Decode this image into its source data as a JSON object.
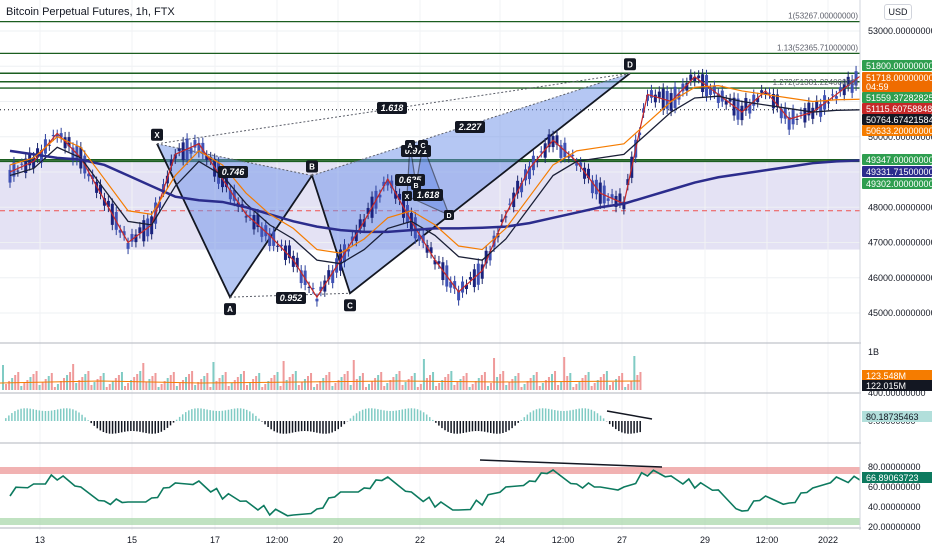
{
  "header": {
    "title": "Bitcoin Perpetual Futures, 1h, FTX",
    "currency": "USD"
  },
  "colors": {
    "price_up": "#26a69a",
    "price_down": "#ef5350",
    "level_line": "#1b5e20",
    "pattern_fill": "#6b8fe8",
    "ma_dark": "#1a1f36",
    "ma_orange": "#f57c00",
    "ma_red": "#c62828",
    "ma_navy": "#2b2c8c",
    "ma_green": "#2e7d32",
    "rsi": "#0d7a5f",
    "zone": "#d9d6ef"
  },
  "chart_data": [
    {
      "type": "line",
      "panel": "price",
      "y_ticks": [
        "53000.00000000",
        "52000.00000000",
        "51000.00000000",
        "50000.00000000",
        "49000.00000000",
        "48000.00000000",
        "47000.00000000",
        "46000.00000000",
        "45000.00000000"
      ],
      "x_ticks": [
        "13",
        "15",
        "17",
        "12:00",
        "20",
        "22",
        "24",
        "12:00",
        "27",
        "29",
        "12:00",
        "2022"
      ],
      "price_labels": [
        {
          "text": "51800.00000000",
          "value": 51800,
          "color": "#2e9e4f"
        },
        {
          "text": "51718.00000000",
          "value": 51718,
          "color": "#ef6c00"
        },
        {
          "text": "04:59",
          "value": 51718,
          "color": "#ef6c00"
        },
        {
          "text": "51559.37282825",
          "value": 51559.37,
          "color": "#2e9e4f"
        },
        {
          "text": "51115.60758848",
          "value": 51115.61,
          "color": "#c62828"
        },
        {
          "text": "50764.67421584",
          "value": 50764.67,
          "color": "#131722"
        },
        {
          "text": "50633.20000000",
          "value": 50633.2,
          "color": "#f57c00"
        },
        {
          "text": "49347.00000000",
          "value": 49347,
          "color": "#2e9e4f"
        },
        {
          "text": "49331.71500000",
          "value": 49331.72,
          "color": "#2b2c8c"
        },
        {
          "text": "49302.00000000",
          "value": 49302,
          "color": "#2e9e4f"
        }
      ],
      "fib_labels": [
        {
          "text": "1(53267.00000000)",
          "value": 53267
        },
        {
          "text": "1.13(52365.71000000)",
          "value": 52365.71
        },
        {
          "text": "1.272(51381.22400000)",
          "value": 51381.22
        }
      ],
      "pattern_points": [
        {
          "label": "X",
          "value": 49800
        },
        {
          "label": "A",
          "value": 45450
        },
        {
          "label": "B",
          "value": 48900
        },
        {
          "label": "C",
          "value": 45560
        },
        {
          "label": "D",
          "value": 51800
        }
      ],
      "inner_pattern_points": [
        "A",
        "C",
        "X",
        "B",
        "D"
      ],
      "ratios": [
        "0.746",
        "0.952",
        "1.618",
        "2.227",
        "0.971",
        "0.625",
        "1.618"
      ],
      "series": [
        {
          "values": [
            49000,
            49300,
            50100,
            49400,
            48200,
            47000,
            47500,
            49500,
            49800,
            48800,
            47800,
            47200,
            46500,
            45450,
            46500,
            47600,
            48800,
            47600,
            46500,
            45600,
            46200,
            47800,
            49100,
            49900,
            49300,
            48400,
            48100,
            51200,
            51000,
            51700,
            51200,
            50700,
            51300,
            50500,
            50700,
            51200,
            51718
          ]
        },
        {
          "name": "",
          "values": [
            48900,
            49100,
            49700,
            49400,
            48500,
            47600,
            47500,
            48600,
            49300,
            48900,
            48100,
            47500,
            47100,
            46500,
            46400,
            46800,
            47400,
            47600,
            47200,
            46600,
            46500,
            47100,
            48000,
            48900,
            49300,
            49400,
            49500,
            50100,
            50700,
            51100,
            51150,
            51000,
            50900,
            50800,
            50700,
            50750,
            50764
          ]
        },
        {
          "values": [
            49600,
            49500,
            49400,
            49350,
            49200,
            48900,
            48600,
            48300,
            48200,
            48150,
            48000,
            47800,
            47600,
            47450,
            47350,
            47300,
            47300,
            47350,
            47400,
            47400,
            47420,
            47450,
            47550,
            47700,
            47850,
            48000,
            48100,
            48300,
            48500,
            48700,
            48850,
            48950,
            49050,
            49150,
            49250,
            49300,
            49331
          ]
        }
      ],
      "reference_lines": [
        51800,
        51559.37,
        49347,
        49302,
        47900
      ],
      "zone": [
        49302,
        46800
      ]
    },
    {
      "type": "bar",
      "panel": "volume",
      "y_ticks": [
        "1B"
      ],
      "labels": [
        {
          "text": "123.548M",
          "value": 123.548
        },
        {
          "text": "122.015M",
          "value": 122.015
        }
      ]
    },
    {
      "type": "bar",
      "panel": "oscillator",
      "y_ticks": [
        "400.00000000",
        "0.00000000"
      ],
      "labels": [
        {
          "text": "80.18735463",
          "value": 80.19
        }
      ]
    },
    {
      "type": "line",
      "panel": "rsi",
      "y_ticks": [
        "80.00000000",
        "60.00000000",
        "40.00000000",
        "20.00000000"
      ],
      "labels": [
        {
          "text": "66.89063723",
          "value": 66.89
        }
      ],
      "ylim": [
        15,
        90
      ],
      "bands": [
        76,
        29
      ],
      "values": [
        55,
        62,
        70,
        58,
        48,
        42,
        50,
        60,
        66,
        52,
        45,
        35,
        30,
        40,
        52,
        60,
        66,
        55,
        44,
        36,
        45,
        58,
        68,
        74,
        64,
        56,
        60,
        75,
        70,
        62,
        55,
        38,
        48,
        45,
        55,
        70,
        66.89
      ]
    }
  ]
}
